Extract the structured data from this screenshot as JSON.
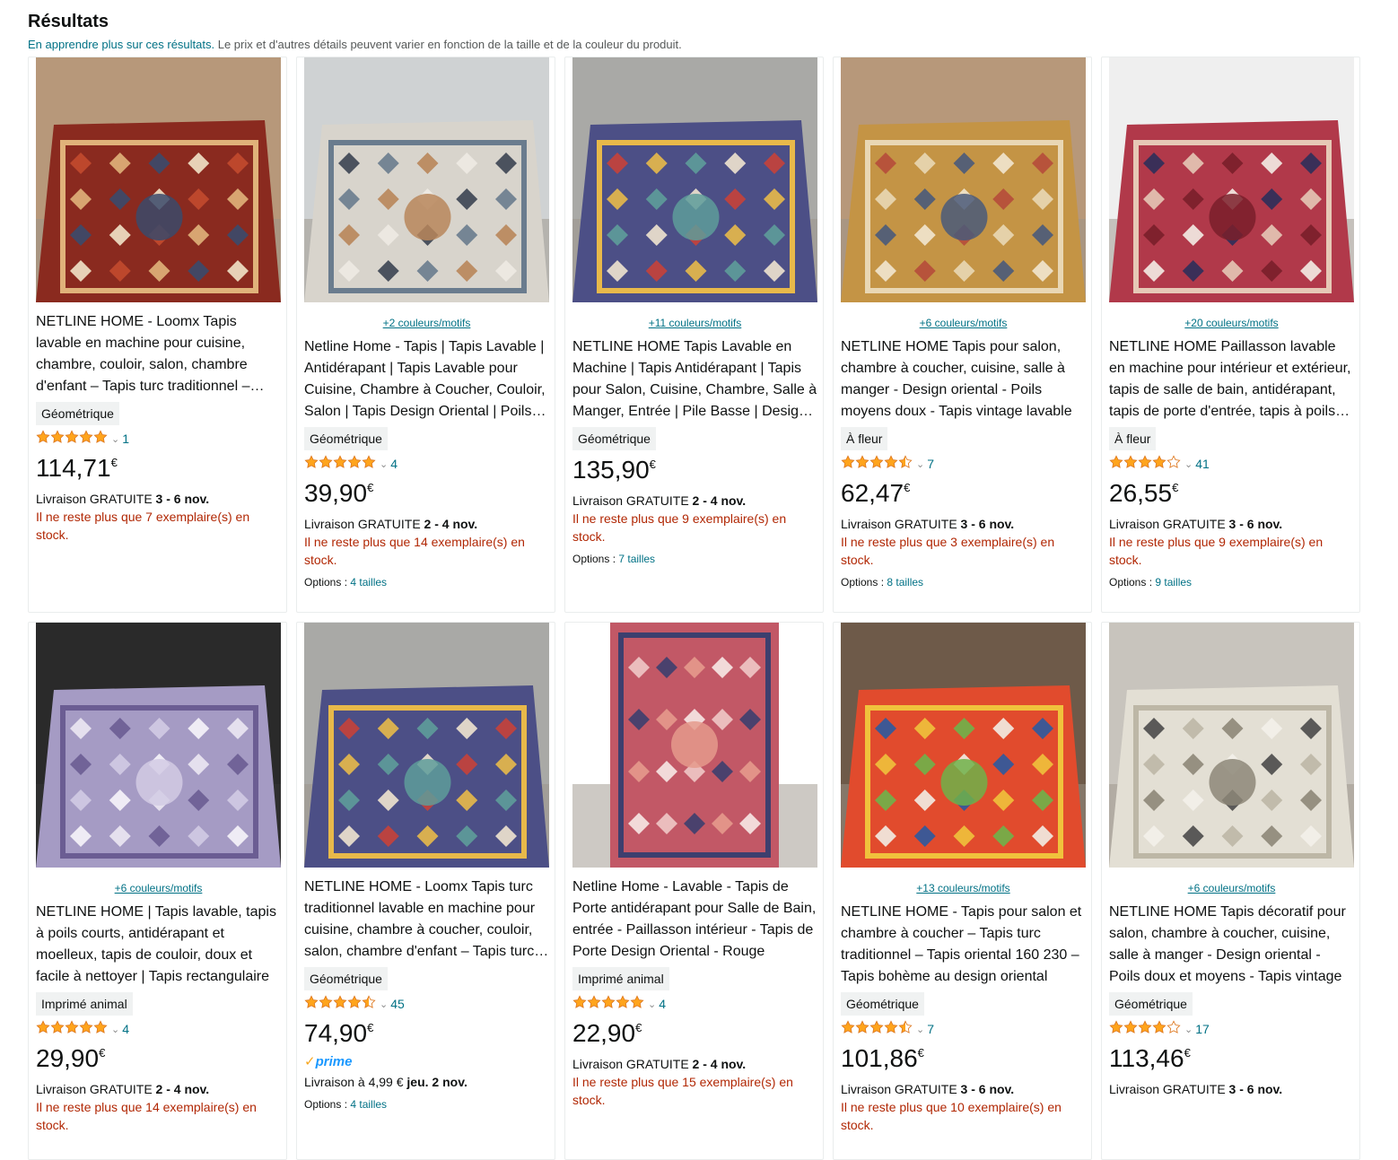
{
  "header": {
    "title": "Résultats",
    "learn_more": "En apprendre plus sur ces résultats.",
    "note": " Le prix et d'autres détails peuvent varier en fonction de la taille et de la couleur du produit."
  },
  "colors": {
    "link": "#007185",
    "stock": "#b12704",
    "star": "#ffa41c",
    "prime": "#1a98ff"
  },
  "products": [
    {
      "swatch": "",
      "title": "NETLINE HOME - Loomx Tapis lavable en machine pour cuisine, chambre, couloir, salon, chambre d'enfant – Tapis turc traditionnel – Tapis patchwork – Tapis oriental",
      "badge": "Géométrique",
      "stars": 5,
      "count": "1",
      "price": "114,71",
      "currency": "€",
      "prime": false,
      "delivery_prefix": "Livraison GRATUITE ",
      "delivery_date": "3 - 6 nov.",
      "stock": "Il ne reste plus que 7 exemplaire(s) en stock.",
      "options_label": "",
      "options_value": ""
    },
    {
      "swatch": "+2 couleurs/motifs",
      "title": "Netline Home - Tapis | Tapis Lavable | Antidérapant | Tapis Lavable pour Cuisine, Chambre à Coucher, Couloir, Salon | Tapis Design Oriental | Poils courts",
      "badge": "Géométrique",
      "stars": 5,
      "count": "4",
      "price": "39,90",
      "currency": "€",
      "prime": false,
      "delivery_prefix": "Livraison GRATUITE ",
      "delivery_date": "2 - 4 nov.",
      "stock": "Il ne reste plus que 14 exemplaire(s) en stock.",
      "options_label": "Options : ",
      "options_value": "4 tailles"
    },
    {
      "swatch": "+11 couleurs/motifs",
      "title": "NETLINE HOME Tapis Lavable en Machine | Tapis Antidérapant | Tapis pour Salon, Cuisine, Chambre, Salle à Manger, Entrée | Pile Basse | Design Kilim",
      "badge": "Géométrique",
      "stars": 0,
      "count": "",
      "price": "135,90",
      "currency": "€",
      "prime": false,
      "delivery_prefix": "Livraison GRATUITE ",
      "delivery_date": "2 - 4 nov.",
      "stock": "Il ne reste plus que 9 exemplaire(s) en stock.",
      "options_label": "Options : ",
      "options_value": "7 tailles"
    },
    {
      "swatch": "+6 couleurs/motifs",
      "title": "NETLINE HOME Tapis pour salon, chambre à coucher, cuisine, salle à manger - Design oriental - Poils moyens doux - Tapis vintage lavable",
      "badge": "À fleur",
      "stars": 4.5,
      "count": "7",
      "price": "62,47",
      "currency": "€",
      "prime": false,
      "delivery_prefix": "Livraison GRATUITE ",
      "delivery_date": "3 - 6 nov.",
      "stock": "Il ne reste plus que 3 exemplaire(s) en stock.",
      "options_label": "Options : ",
      "options_value": "8 tailles"
    },
    {
      "swatch": "+20 couleurs/motifs",
      "title": "NETLINE HOME Paillasson lavable en machine pour intérieur et extérieur, tapis de salle de bain, antidérapant, tapis de porte d'entrée, tapis à poils courts",
      "badge": "À fleur",
      "stars": 4,
      "count": "41",
      "price": "26,55",
      "currency": "€",
      "prime": false,
      "delivery_prefix": "Livraison GRATUITE ",
      "delivery_date": "3 - 6 nov.",
      "stock": "Il ne reste plus que 9 exemplaire(s) en stock.",
      "options_label": "Options : ",
      "options_value": "9 tailles"
    },
    {
      "swatch": "+6 couleurs/motifs",
      "title": "NETLINE HOME | Tapis lavable, tapis à poils courts, antidérapant et moelleux, tapis de couloir, doux et facile à nettoyer | Tapis rectangulaire",
      "badge": "Imprimé animal",
      "stars": 5,
      "count": "4",
      "price": "29,90",
      "currency": "€",
      "prime": false,
      "delivery_prefix": "Livraison GRATUITE ",
      "delivery_date": "2 - 4 nov.",
      "stock": "Il ne reste plus que 14 exemplaire(s) en stock.",
      "options_label": "",
      "options_value": ""
    },
    {
      "swatch": "",
      "title": "NETLINE HOME - Loomx Tapis turc traditionnel lavable en machine pour cuisine, chambre à coucher, couloir, salon, chambre d'enfant – Tapis turc patchwork",
      "badge": "Géométrique",
      "stars": 4.5,
      "count": "45",
      "price": "74,90",
      "currency": "€",
      "prime": true,
      "prime_label": "prime",
      "delivery_prefix": "Livraison à 4,99 € ",
      "delivery_date": "jeu. 2 nov.",
      "stock": "",
      "options_label": "Options : ",
      "options_value": "4 tailles"
    },
    {
      "swatch": "",
      "title": "Netline Home - Lavable - Tapis de Porte antidérapant pour Salle de Bain, entrée - Paillasson intérieur - Tapis de Porte Design Oriental - Rouge",
      "badge": "Imprimé animal",
      "stars": 5,
      "count": "4",
      "price": "22,90",
      "currency": "€",
      "prime": false,
      "delivery_prefix": "Livraison GRATUITE ",
      "delivery_date": "2 - 4 nov.",
      "stock": "Il ne reste plus que 15 exemplaire(s) en stock.",
      "options_label": "",
      "options_value": ""
    },
    {
      "swatch": "+13 couleurs/motifs",
      "title": "NETLINE HOME - Tapis pour salon et chambre à coucher – Tapis turc traditionnel – Tapis oriental 160 230 – Tapis bohème au design oriental",
      "badge": "Géométrique",
      "stars": 4.5,
      "count": "7",
      "price": "101,86",
      "currency": "€",
      "prime": false,
      "delivery_prefix": "Livraison GRATUITE ",
      "delivery_date": "3 - 6 nov.",
      "stock": "Il ne reste plus que 10 exemplaire(s) en stock.",
      "options_label": "",
      "options_value": ""
    },
    {
      "swatch": "+6 couleurs/motifs",
      "title": "NETLINE HOME Tapis décoratif pour salon, chambre à coucher, cuisine, salle à manger - Design oriental - Poils doux et moyens - Tapis vintage",
      "badge": "Géométrique",
      "stars": 4,
      "count": "17",
      "price": "113,46",
      "currency": "€",
      "prime": false,
      "delivery_prefix": "Livraison GRATUITE ",
      "delivery_date": "3 - 6 nov.",
      "stock": "",
      "options_label": "",
      "options_value": ""
    }
  ]
}
